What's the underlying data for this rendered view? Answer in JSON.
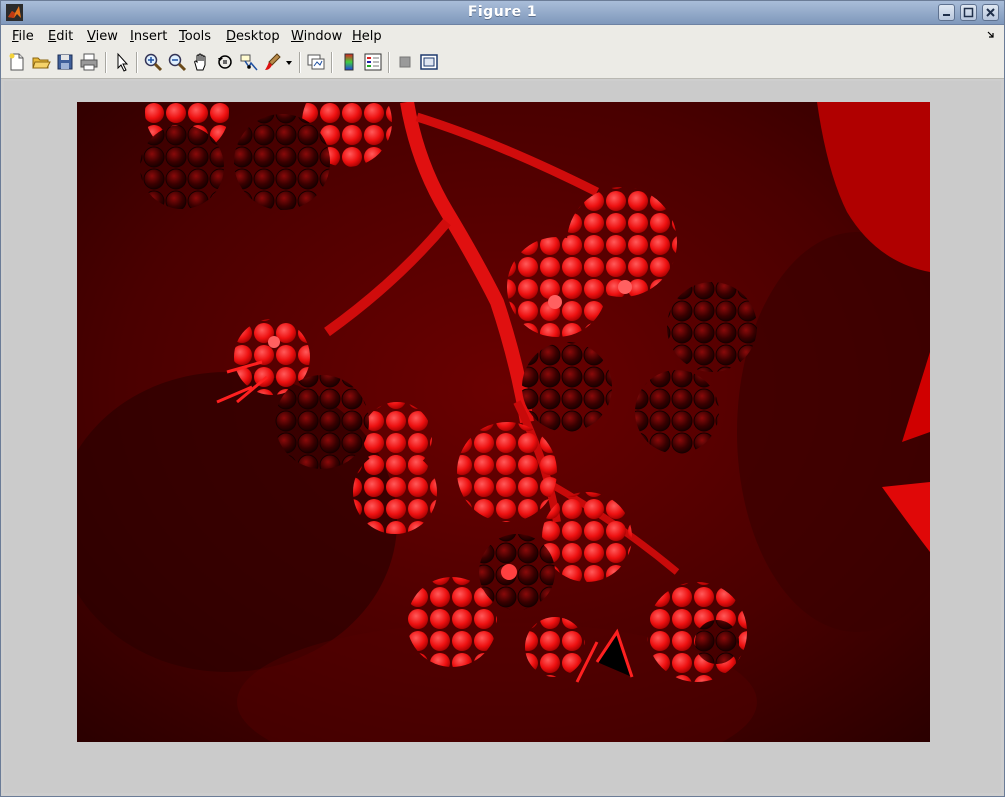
{
  "window": {
    "title": "Figure 1"
  },
  "menubar": {
    "items": [
      {
        "label": "File",
        "key": "F",
        "rest": "ile"
      },
      {
        "label": "Edit",
        "key": "E",
        "rest": "dit"
      },
      {
        "label": "View",
        "key": "V",
        "rest": "iew"
      },
      {
        "label": "Insert",
        "key": "I",
        "rest": "nsert"
      },
      {
        "label": "Tools",
        "key": "T",
        "rest": "ools"
      },
      {
        "label": "Desktop",
        "key": "D",
        "rest": "esktop"
      },
      {
        "label": "Window",
        "key": "W",
        "rest": "indow"
      },
      {
        "label": "Help",
        "key": "H",
        "rest": "elp"
      }
    ]
  },
  "toolbar": {
    "icons": [
      "new-figure-icon",
      "open-file-icon",
      "save-figure-icon",
      "print-figure-icon",
      "edit-plot-icon",
      "zoom-in-icon",
      "zoom-out-icon",
      "pan-icon",
      "rotate-3d-icon",
      "data-cursor-icon",
      "brush-icon",
      "link-plot-icon",
      "insert-colorbar-icon",
      "insert-legend-icon",
      "hide-plot-tools-icon",
      "show-plot-tools-icon"
    ]
  },
  "colors": {
    "image_background": "#3a0000",
    "image_highlight": "#ff1a1a",
    "title_bar": "#8aa2c4"
  },
  "image": {
    "description_icon": "red-channel-photo-image"
  }
}
